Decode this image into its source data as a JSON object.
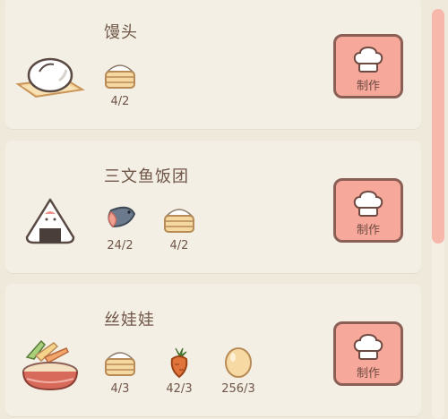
{
  "recipes": [
    {
      "name": "馒头",
      "dish_icon": "steamed-bun",
      "ingredients": [
        {
          "icon": "flour-bowl",
          "count": "4/2"
        }
      ],
      "button_label": "制作"
    },
    {
      "name": "三文鱼饭团",
      "dish_icon": "onigiri",
      "ingredients": [
        {
          "icon": "salmon",
          "count": "24/2"
        },
        {
          "icon": "flour-bowl",
          "count": "4/2"
        }
      ],
      "button_label": "制作"
    },
    {
      "name": "丝娃娃",
      "dish_icon": "spring-roll-basket",
      "ingredients": [
        {
          "icon": "flour-bowl",
          "count": "4/3"
        },
        {
          "icon": "carrot",
          "count": "42/3"
        },
        {
          "icon": "egg",
          "count": "256/3"
        }
      ],
      "button_label": "制作"
    }
  ],
  "scrollbar": {
    "position_fraction": 0.0
  },
  "colors": {
    "button_fill": "#f6a99a",
    "button_border": "#8b5f55",
    "text": "#6f5648",
    "card": "#f4efe4",
    "background": "#efe9dc"
  }
}
